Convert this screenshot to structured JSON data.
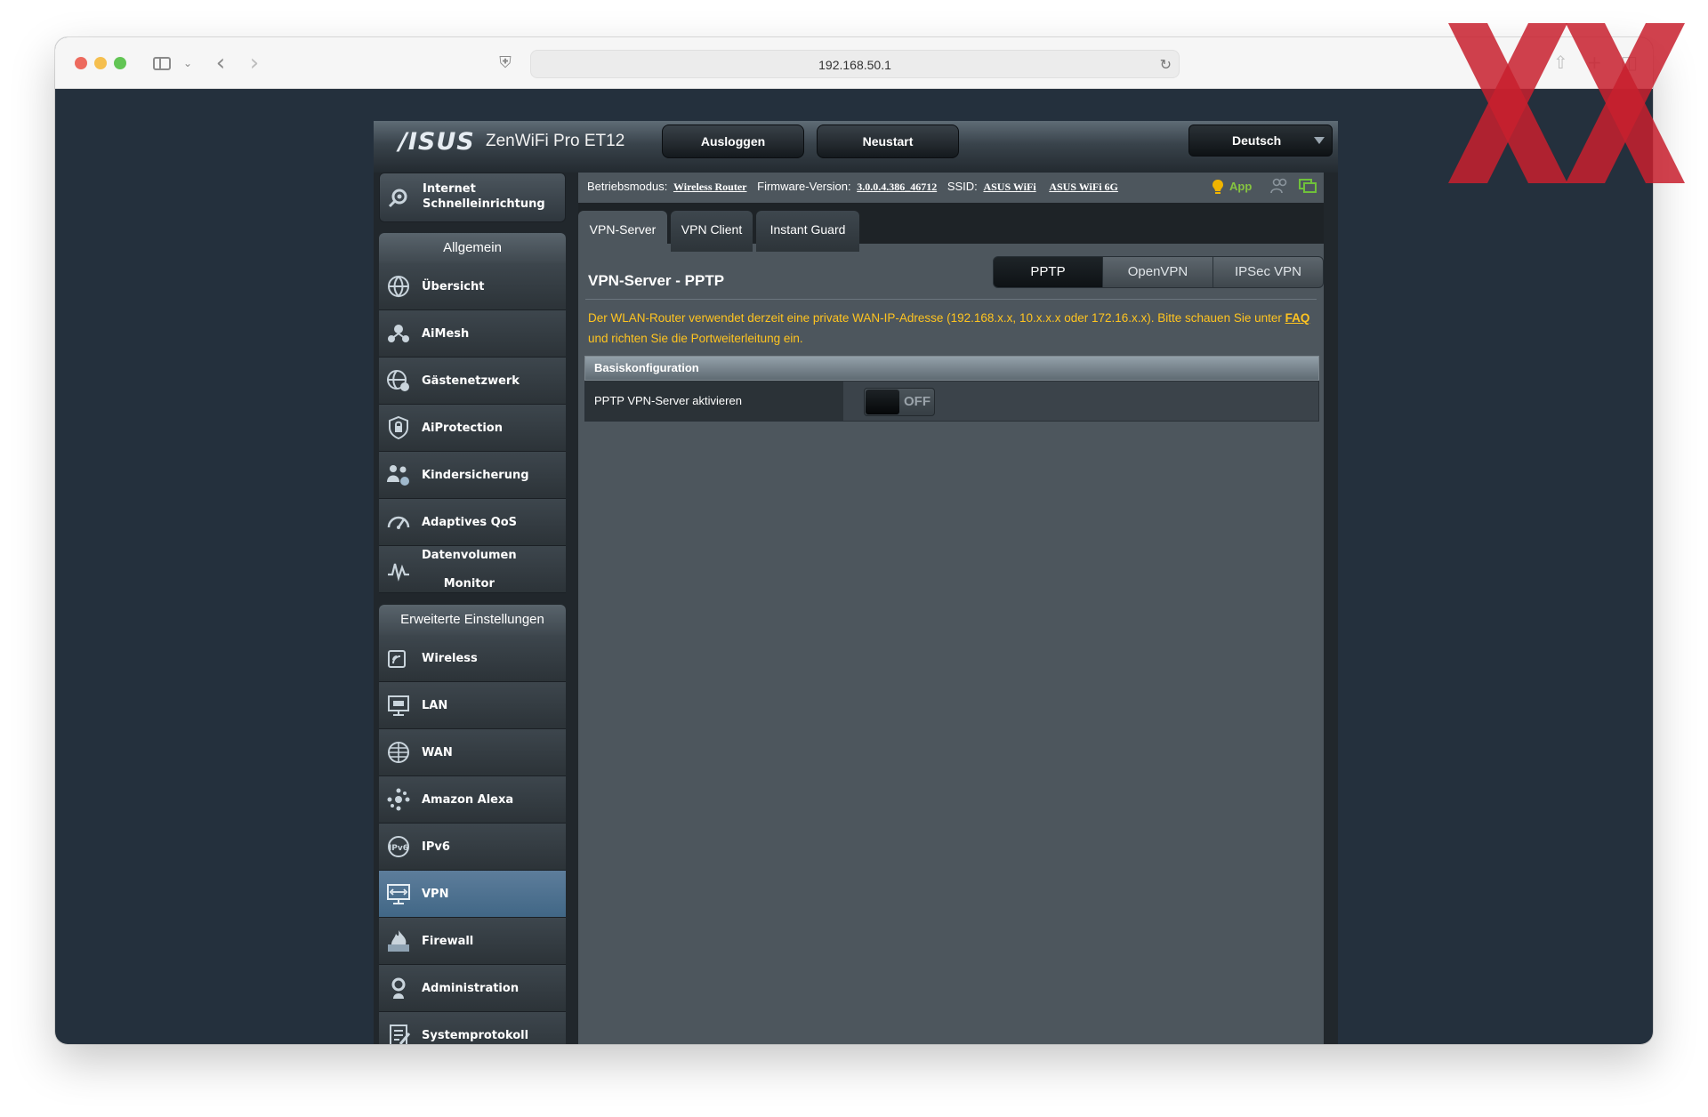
{
  "browser": {
    "url": "192.168.50.1"
  },
  "header": {
    "logo": "/ISUS",
    "model": "ZenWiFi Pro ET12",
    "logout": "Ausloggen",
    "reboot": "Neustart",
    "language": "Deutsch"
  },
  "quick_setup": {
    "line1": "Internet",
    "line2": "Schnelleinrichtung"
  },
  "menu_general": {
    "title": "Allgemein",
    "items": [
      {
        "label": "Übersicht",
        "icon": "globe-icon"
      },
      {
        "label": "AiMesh",
        "icon": "mesh-icon"
      },
      {
        "label": "Gästenetzwerk",
        "icon": "guest-network-icon"
      },
      {
        "label": "AiProtection",
        "icon": "lock-shield-icon"
      },
      {
        "label": "Kindersicherung",
        "icon": "family-icon"
      },
      {
        "label": "Adaptives QoS",
        "icon": "speedometer-icon"
      },
      {
        "label": "Datenvolumen",
        "label2": "Monitor",
        "icon": "traffic-monitor-icon"
      }
    ]
  },
  "menu_advanced": {
    "title": "Erweiterte Einstellungen",
    "items": [
      {
        "label": "Wireless",
        "icon": "wireless-icon"
      },
      {
        "label": "LAN",
        "icon": "lan-icon"
      },
      {
        "label": "WAN",
        "icon": "wan-globe-icon"
      },
      {
        "label": "Amazon Alexa",
        "icon": "alexa-icon"
      },
      {
        "label": "IPv6",
        "icon": "ipv6-icon"
      },
      {
        "label": "VPN",
        "icon": "vpn-icon"
      },
      {
        "label": "Firewall",
        "icon": "firewall-icon"
      },
      {
        "label": "Administration",
        "icon": "administration-icon"
      },
      {
        "label": "Systemprotokoll",
        "icon": "system-log-icon"
      }
    ],
    "active": "VPN"
  },
  "status": {
    "mode_label": "Betriebsmodus:",
    "mode_value": "Wireless Router",
    "firmware_label": "Firmware-Version:",
    "firmware_value": "3.0.0.4.386_46712",
    "ssid_label": "SSID:",
    "ssid_1": "ASUS WiFi",
    "ssid_2": "ASUS WiFi 6G",
    "app": "App"
  },
  "tabs": [
    "VPN-Server",
    "VPN Client",
    "Instant Guard"
  ],
  "active_tab": "VPN-Server",
  "page": {
    "title": "VPN-Server - PPTP",
    "segments": [
      "PPTP",
      "OpenVPN",
      "IPSec VPN"
    ],
    "active_segment": "PPTP",
    "notice_before": "Der WLAN-Router verwendet derzeit eine private WAN-IP-Adresse (192.168.x.x, 10.x.x.x oder 172.16.x.x). Bitte schauen Sie unter ",
    "notice_link": "FAQ",
    "notice_after": " und richten Sie die Portweiterleitung ein.",
    "section_title": "Basiskonfiguration",
    "row_label": "PPTP VPN-Server aktivieren",
    "toggle_state": "OFF"
  },
  "colors": {
    "accent_active": "#416786",
    "notice": "#ffc420",
    "app_green": "#86c440"
  }
}
